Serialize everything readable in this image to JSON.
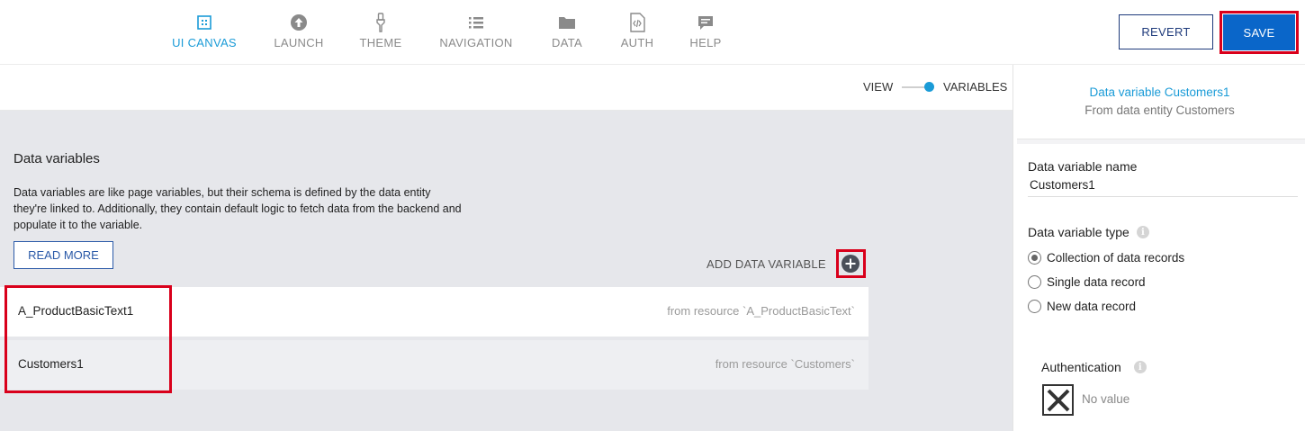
{
  "nav": {
    "items": [
      {
        "label": "UI CANVAS",
        "icon": "ui-canvas-icon",
        "active": true
      },
      {
        "label": "LAUNCH",
        "icon": "launch-icon",
        "active": false
      },
      {
        "label": "THEME",
        "icon": "theme-icon",
        "active": false
      },
      {
        "label": "NAVIGATION",
        "icon": "navigation-icon",
        "active": false
      },
      {
        "label": "DATA",
        "icon": "folder-icon",
        "active": false
      },
      {
        "label": "AUTH",
        "icon": "auth-icon",
        "active": false
      },
      {
        "label": "HELP",
        "icon": "help-icon",
        "active": false
      }
    ]
  },
  "toolbar": {
    "revert_label": "REVERT",
    "save_label": "SAVE"
  },
  "view_toggle": {
    "left_label": "VIEW",
    "right_label": "VARIABLES",
    "selected": "VARIABLES"
  },
  "main": {
    "title": "Data variables",
    "description": "Data variables are like page variables, but their schema is defined by the data entity they're linked to. Additionally, they contain default logic to fetch data from the backend and populate it to the variable.",
    "read_more_label": "READ MORE",
    "add_label": "ADD DATA VARIABLE",
    "variables": [
      {
        "name": "A_ProductBasicText1",
        "source": "from resource `A_ProductBasicText`"
      },
      {
        "name": "Customers1",
        "source": "from resource `Customers`"
      }
    ]
  },
  "panel": {
    "title": "Data variable Customers1",
    "subtitle": "From data entity Customers",
    "name_label": "Data variable name",
    "name_value": "Customers1",
    "type_label": "Data variable type",
    "type_options": [
      {
        "label": "Collection of data records",
        "checked": true
      },
      {
        "label": "Single data record",
        "checked": false
      },
      {
        "label": "New data record",
        "checked": false
      }
    ],
    "auth_label": "Authentication",
    "auth_value": "No value"
  },
  "colors": {
    "accent": "#1a9bd7",
    "save": "#0a66c9",
    "highlight": "#d9001b",
    "main_bg": "#e6e7eb"
  }
}
